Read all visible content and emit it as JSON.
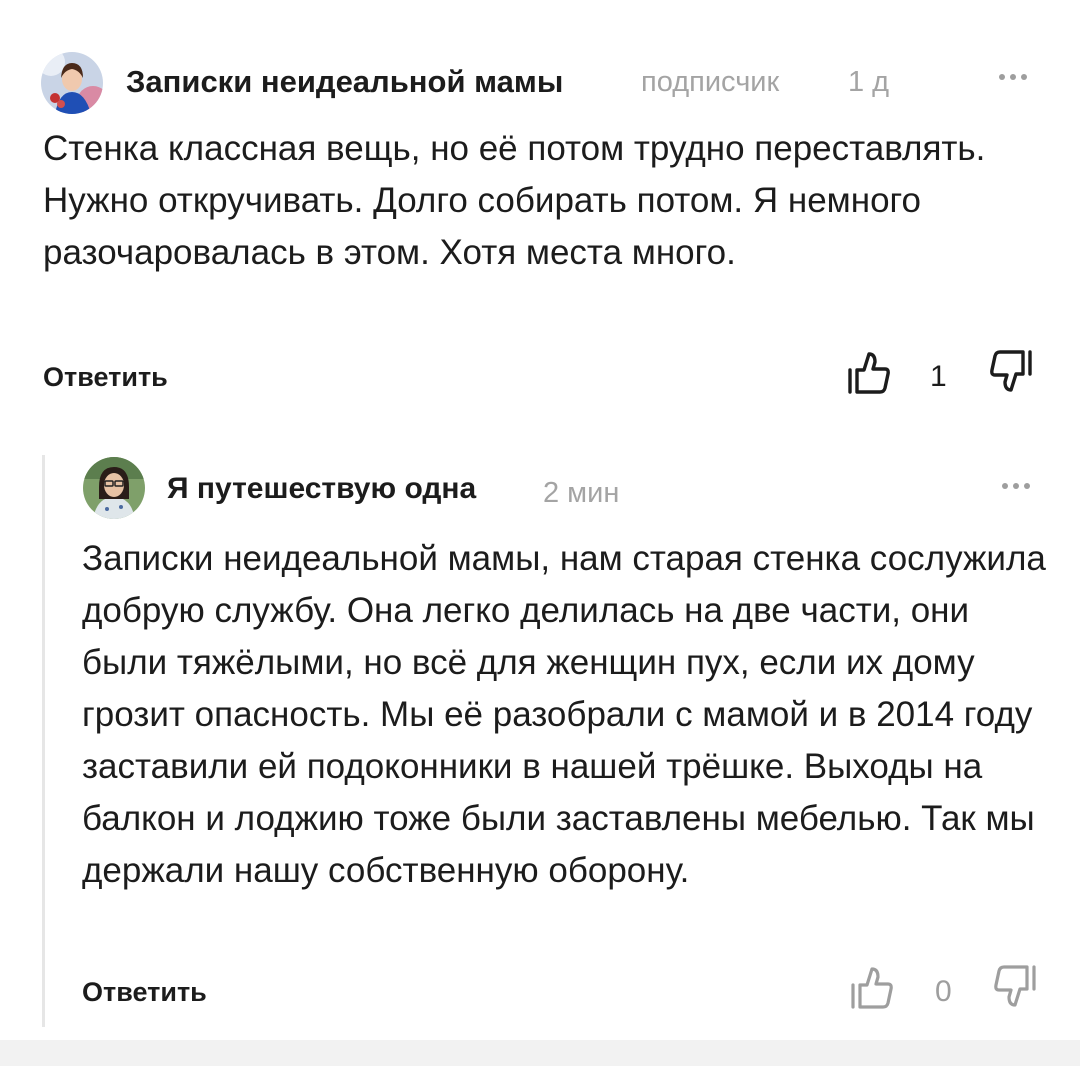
{
  "comments": [
    {
      "author": "Записки неидеальной мамы",
      "badge": "подписчик",
      "time": "1 д",
      "text": "Стенка классная вещь, но её потом трудно переставлять. Нужно откручивать. Долго собирать потом. Я немного разочаровалась в этом. Хотя места много.",
      "reply_label": "Ответить",
      "likes": "1"
    },
    {
      "author": "Я путешествую одна",
      "time": "2 мин",
      "text": "Записки неидеальной мамы, нам старая стенка сослужила добрую службу. Она легко делилась на две части, они были тяжёлыми, но всё для женщин пух, если их дому грозит опасность. Мы её разобрали с мамой и в 2014 году заставили ей подоконники в нашей трёшке. Выходы на балкон и лоджию тоже были заставлены мебелью. Так мы держали нашу собственную оборону.",
      "reply_label": "Ответить",
      "likes": "0"
    }
  ],
  "icons": [
    "avatar",
    "more-icon",
    "thumbs-up-icon",
    "thumbs-down-icon"
  ]
}
